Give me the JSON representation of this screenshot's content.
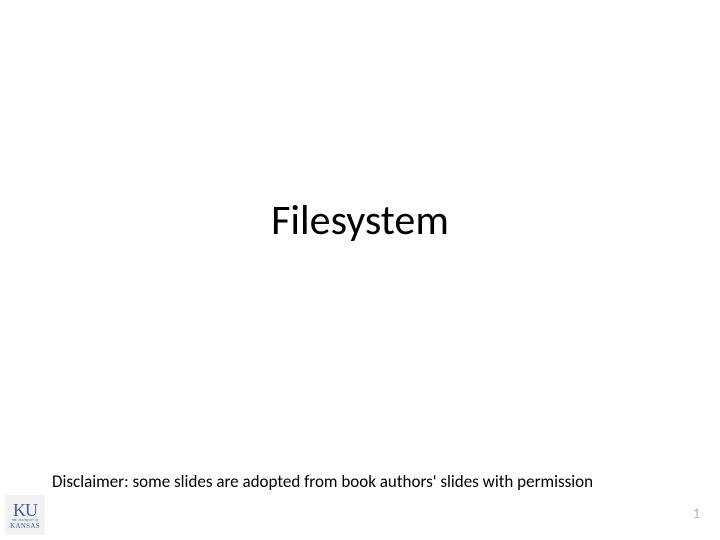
{
  "slide": {
    "title": "Filesystem",
    "disclaimer": "Disclaimer: some slides are adopted from book authors' slides with permission",
    "page_number": "1",
    "logo": {
      "top": "KU",
      "bottom": "KANSAS"
    }
  }
}
